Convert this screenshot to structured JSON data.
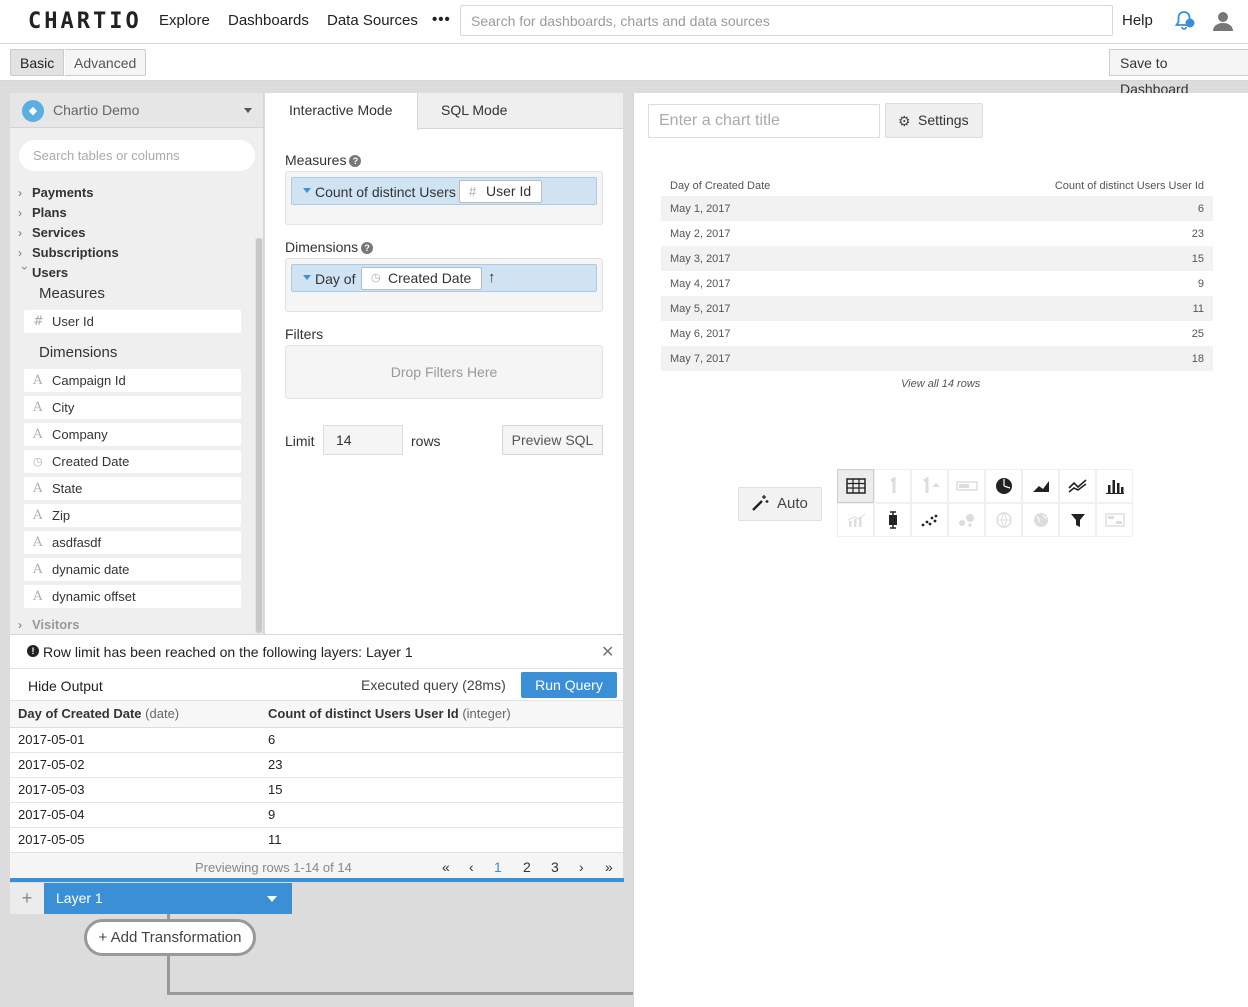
{
  "app": {
    "logo": "CHARTIO",
    "nav": [
      "Explore",
      "Dashboards",
      "Data Sources"
    ],
    "more": "•••",
    "search_placeholder": "Search for dashboards, charts and data sources",
    "help": "Help"
  },
  "subbar": {
    "basic": "Basic",
    "advanced": "Advanced",
    "save": "Save to Dashboard"
  },
  "sidebar": {
    "datasource": "Chartio Demo",
    "search_placeholder": "Search tables or columns",
    "tables": [
      {
        "label": "Payments",
        "expanded": false
      },
      {
        "label": "Plans",
        "expanded": false
      },
      {
        "label": "Services",
        "expanded": false
      },
      {
        "label": "Subscriptions",
        "expanded": false
      },
      {
        "label": "Users",
        "expanded": true
      }
    ],
    "measures_label": "Measures",
    "measures": [
      {
        "label": "User Id",
        "icon": "#"
      }
    ],
    "dimensions_label": "Dimensions",
    "dimensions": [
      {
        "label": "Campaign Id",
        "icon": "A"
      },
      {
        "label": "City",
        "icon": "A"
      },
      {
        "label": "Company",
        "icon": "A"
      },
      {
        "label": "Created Date",
        "icon": "clock"
      },
      {
        "label": "State",
        "icon": "A"
      },
      {
        "label": "Zip",
        "icon": "A"
      },
      {
        "label": "asdfasdf",
        "icon": "A"
      },
      {
        "label": "dynamic date",
        "icon": "A"
      },
      {
        "label": "dynamic offset",
        "icon": "A"
      }
    ],
    "visitors": "Visitors"
  },
  "builder": {
    "tab_interactive": "Interactive Mode",
    "tab_sql": "SQL Mode",
    "measures_label": "Measures",
    "measure_pill": {
      "agg": "Count of distinct Users",
      "field": "User Id"
    },
    "dimensions_label": "Dimensions",
    "dimension_pill": {
      "agg": "Day of",
      "field": "Created Date",
      "sort": "↑"
    },
    "filters_label": "Filters",
    "drop_filters": "Drop Filters Here",
    "limit_label": "Limit",
    "limit_value": "14",
    "rows_label": "rows",
    "preview_sql": "Preview SQL"
  },
  "output": {
    "warning": "Row limit has been reached on the following layers: Layer 1",
    "hide_output": "Hide Output",
    "executed": "Executed query (28ms)",
    "run_query": "Run Query",
    "col1": "Day of Created Date",
    "col1_type": "(date)",
    "col2": "Count of distinct Users User Id",
    "col2_type": "(integer)",
    "rows": [
      [
        "2017-05-01",
        "6"
      ],
      [
        "2017-05-02",
        "23"
      ],
      [
        "2017-05-03",
        "15"
      ],
      [
        "2017-05-04",
        "9"
      ],
      [
        "2017-05-05",
        "11"
      ]
    ],
    "previewing": "Previewing rows 1-14 of 14",
    "pager": [
      "«",
      "‹",
      "1",
      "2",
      "3",
      "›",
      "»"
    ]
  },
  "layers": {
    "layer1": "Layer 1",
    "add_transformation": "Add Transformation"
  },
  "chart": {
    "title_placeholder": "Enter a chart title",
    "settings": "Settings",
    "col1": "Day of Created Date",
    "col2": "Count of distinct Users User Id",
    "rows": [
      [
        "May 1, 2017",
        "6"
      ],
      [
        "May 2, 2017",
        "23"
      ],
      [
        "May 3, 2017",
        "15"
      ],
      [
        "May 4, 2017",
        "9"
      ],
      [
        "May 5, 2017",
        "11"
      ],
      [
        "May 6, 2017",
        "25"
      ],
      [
        "May 7, 2017",
        "18"
      ]
    ],
    "view_all": "View all 14 rows",
    "auto": "Auto",
    "selected_type": "table",
    "accent": "#3b8fd6"
  }
}
